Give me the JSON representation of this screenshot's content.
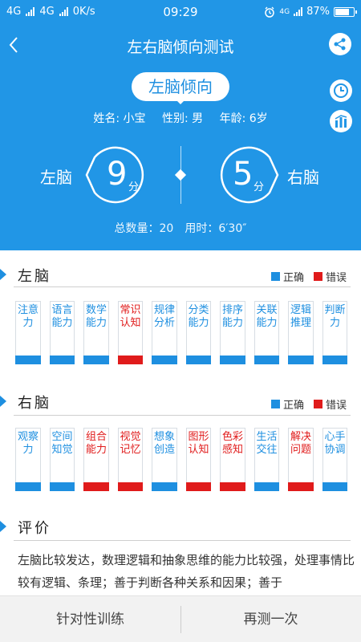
{
  "status_bar": {
    "net1": "4G",
    "net2": "4G",
    "speed": "0K/s",
    "time": "09:29",
    "net3": "4G",
    "battery": "87%",
    "battery_level": 87
  },
  "nav": {
    "title": "左右脑倾向测试"
  },
  "result": {
    "badge": "左脑倾向",
    "name": "姓名: 小宝",
    "gender": "性别: 男",
    "age": "年龄: 6岁",
    "left_label": "左脑",
    "left_score": "9",
    "right_label": "右脑",
    "right_score": "5",
    "unit": "分",
    "summary": "总数量：20　用时：6′30″"
  },
  "legend": {
    "correct": "正确",
    "wrong": "错误"
  },
  "colors": {
    "brand": "#2196e6",
    "correct": "#1e8fe0",
    "wrong": "#e01b1b"
  },
  "left_section": {
    "title": "左脑",
    "items": [
      {
        "text": "注意力",
        "status": "correct"
      },
      {
        "text": "语言能力",
        "status": "correct"
      },
      {
        "text": "数学能力",
        "status": "correct"
      },
      {
        "text": "常识认知",
        "status": "wrong"
      },
      {
        "text": "规律分析",
        "status": "correct"
      },
      {
        "text": "分类能力",
        "status": "correct"
      },
      {
        "text": "排序能力",
        "status": "correct"
      },
      {
        "text": "关联能力",
        "status": "correct"
      },
      {
        "text": "逻辑推理",
        "status": "correct"
      },
      {
        "text": "判断力",
        "status": "correct"
      }
    ]
  },
  "right_section": {
    "title": "右脑",
    "items": [
      {
        "text": "观察力",
        "status": "correct"
      },
      {
        "text": "空间知觉",
        "status": "correct"
      },
      {
        "text": "组合能力",
        "status": "wrong"
      },
      {
        "text": "视觉记忆",
        "status": "wrong"
      },
      {
        "text": "想象创造",
        "status": "correct"
      },
      {
        "text": "图形认知",
        "status": "wrong"
      },
      {
        "text": "色彩感知",
        "status": "wrong"
      },
      {
        "text": "生活交往",
        "status": "correct"
      },
      {
        "text": "解决问题",
        "status": "wrong"
      },
      {
        "text": "心手协调",
        "status": "correct"
      }
    ]
  },
  "evaluation": {
    "title": "评价",
    "text": "左脑比较发达，数理逻辑和抽象思维的能力比较强，处理事情比较有逻辑、条理；善于判断各种关系和因果；善于"
  },
  "bottom": {
    "train": "针对性训练",
    "retest": "再测一次"
  },
  "icons": {
    "back": "back-chevron-icon",
    "share": "share-icon",
    "history": "clock-icon",
    "stats": "bar-chart-icon"
  }
}
